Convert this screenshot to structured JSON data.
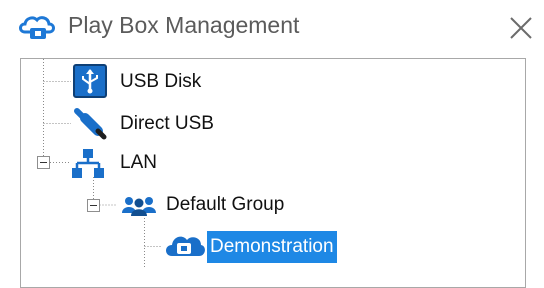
{
  "window": {
    "title": "Play Box Management",
    "app_icon": "cloud-box-icon",
    "close_icon": "close-icon"
  },
  "tree": {
    "nodes": [
      {
        "label": "USB Disk",
        "icon": "usb-disk-icon",
        "level": 1,
        "expanded": null
      },
      {
        "label": "Direct USB",
        "icon": "usb-cable-icon",
        "level": 1,
        "expanded": null
      },
      {
        "label": "LAN",
        "icon": "network-icon",
        "level": 1,
        "expanded": true
      },
      {
        "label": "Default Group",
        "icon": "group-icon",
        "level": 2,
        "expanded": true
      },
      {
        "label": "Demonstration",
        "icon": "play-box-icon",
        "level": 3,
        "expanded": null,
        "selected": true
      }
    ]
  },
  "colors": {
    "selection": "#1e88e5",
    "accent_blue": "#1565c0",
    "text": "#111111",
    "title_text": "#5b5b5b"
  }
}
